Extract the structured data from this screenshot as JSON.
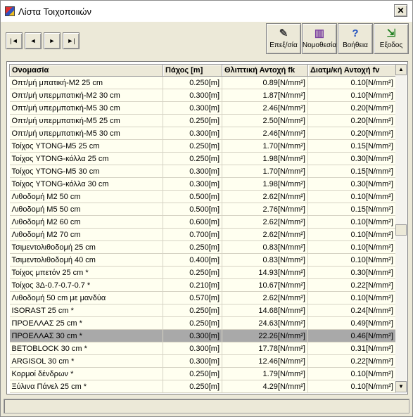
{
  "window": {
    "title": "Λίστα Τοιχοποιιών"
  },
  "toolbar": {
    "buttons": [
      {
        "label": "Επεξ/σία",
        "icon": "edit-icon"
      },
      {
        "label": "Νομοθεσία",
        "icon": "books-icon"
      },
      {
        "label": "Βοήθεια",
        "icon": "help-icon"
      },
      {
        "label": "Εξοδος",
        "icon": "exit-icon"
      }
    ]
  },
  "nav": {
    "first": "|◄",
    "prev": "◄",
    "next": "►",
    "last": "►|"
  },
  "grid": {
    "columns": [
      "Ονομασία",
      "Πάχος [m]",
      "Θλιπτική Αντοχή fk",
      "Διατμ/κή Αντοχή fv"
    ],
    "rows": [
      {
        "name": "Οπτ/μή μπατική-Μ2 25 cm",
        "thickness": "0.250",
        "tu": "[m]",
        "fk": "0.89",
        "fku": "[N/mm²]",
        "fv": "0.10",
        "fvu": "[N/mm²]"
      },
      {
        "name": "Οπτ/μή υπερμπατική-Μ2 30 cm",
        "thickness": "0.300",
        "tu": "[m]",
        "fk": "1.87",
        "fku": "[N/mm²]",
        "fv": "0.10",
        "fvu": "[N/mm²]"
      },
      {
        "name": "Οπτ/μή υπερμπατική-Μ5 30 cm",
        "thickness": "0.300",
        "tu": "[m]",
        "fk": "2.46",
        "fku": "[N/mm²]",
        "fv": "0.20",
        "fvu": "[N/mm²]"
      },
      {
        "name": "Οπτ/μή υπερμπατική-Μ5 25 cm",
        "thickness": "0.250",
        "tu": "[m]",
        "fk": "2.50",
        "fku": "[N/mm²]",
        "fv": "0.20",
        "fvu": "[N/mm²]"
      },
      {
        "name": "Οπτ/μή υπερμπατική-Μ5 30 cm",
        "thickness": "0.300",
        "tu": "[m]",
        "fk": "2.46",
        "fku": "[N/mm²]",
        "fv": "0.20",
        "fvu": "[N/mm²]"
      },
      {
        "name": "Τοίχος YTONG-Μ5 25 cm",
        "thickness": "0.250",
        "tu": "[m]",
        "fk": "1.70",
        "fku": "[N/mm²]",
        "fv": "0.15",
        "fvu": "[N/mm²]"
      },
      {
        "name": "Τοίχος YTONG-κόλλα 25 cm",
        "thickness": "0.250",
        "tu": "[m]",
        "fk": "1.98",
        "fku": "[N/mm²]",
        "fv": "0.30",
        "fvu": "[N/mm²]"
      },
      {
        "name": "Τοίχος YTONG-Μ5 30 cm",
        "thickness": "0.300",
        "tu": "[m]",
        "fk": "1.70",
        "fku": "[N/mm²]",
        "fv": "0.15",
        "fvu": "[N/mm²]"
      },
      {
        "name": "Τοίχος YTONG-κόλλα 30 cm",
        "thickness": "0.300",
        "tu": "[m]",
        "fk": "1.98",
        "fku": "[N/mm²]",
        "fv": "0.30",
        "fvu": "[N/mm²]"
      },
      {
        "name": "Λιθοδομή Μ2 50 cm",
        "thickness": "0.500",
        "tu": "[m]",
        "fk": "2.62",
        "fku": "[N/mm²]",
        "fv": "0.10",
        "fvu": "[N/mm²]"
      },
      {
        "name": "Λιθοδομή Μ5 50 cm",
        "thickness": "0.500",
        "tu": "[m]",
        "fk": "2.76",
        "fku": "[N/mm²]",
        "fv": "0.15",
        "fvu": "[N/mm²]"
      },
      {
        "name": "Λιθοδομή Μ2 60 cm",
        "thickness": "0.600",
        "tu": "[m]",
        "fk": "2.62",
        "fku": "[N/mm²]",
        "fv": "0.10",
        "fvu": "[N/mm²]"
      },
      {
        "name": "Λιθοδομή Μ2 70 cm",
        "thickness": "0.700",
        "tu": "[m]",
        "fk": "2.62",
        "fku": "[N/mm²]",
        "fv": "0.10",
        "fvu": "[N/mm²]"
      },
      {
        "name": "Τσιμεντολιθοδομή 25 cm",
        "thickness": "0.250",
        "tu": "[m]",
        "fk": "0.83",
        "fku": "[N/mm²]",
        "fv": "0.10",
        "fvu": "[N/mm²]"
      },
      {
        "name": "Τσιμεντολιθοδομή 40 cm",
        "thickness": "0.400",
        "tu": "[m]",
        "fk": "0.83",
        "fku": "[N/mm²]",
        "fv": "0.10",
        "fvu": "[N/mm²]"
      },
      {
        "name": "Τοίχος μπετόν 25 cm *",
        "thickness": "0.250",
        "tu": "[m]",
        "fk": "14.93",
        "fku": "[N/mm²]",
        "fv": "0.30",
        "fvu": "[N/mm²]"
      },
      {
        "name": "Τοίχος 3Δ-0.7-0.7-0.7 *",
        "thickness": "0.210",
        "tu": "[m]",
        "fk": "10.67",
        "fku": "[N/mm²]",
        "fv": "0.22",
        "fvu": "[N/mm²]"
      },
      {
        "name": "Λιθοδομή 50 cm με μανδύα",
        "thickness": "0.570",
        "tu": "[m]",
        "fk": "2.62",
        "fku": "[N/mm²]",
        "fv": "0.10",
        "fvu": "[N/mm²]"
      },
      {
        "name": "ISORAST 25 cm *",
        "thickness": "0.250",
        "tu": "[m]",
        "fk": "14.68",
        "fku": "[N/mm²]",
        "fv": "0.24",
        "fvu": "[N/mm²]"
      },
      {
        "name": "ΠΡΟΕΛΛΑΣ 25 cm *",
        "thickness": "0.250",
        "tu": "[m]",
        "fk": "24.63",
        "fku": "[N/mm²]",
        "fv": "0.49",
        "fvu": "[N/mm²]"
      },
      {
        "name": "ΠΡΟΕΛΛΑΣ 30 cm *",
        "thickness": "0.300",
        "tu": "[m]",
        "fk": "22.26",
        "fku": "[N/mm²]",
        "fv": "0.46",
        "fvu": "[N/mm²]",
        "selected": true
      },
      {
        "name": "BETOBLOCK 30 cm  *",
        "thickness": "0.300",
        "tu": "[m]",
        "fk": "17.78",
        "fku": "[N/mm²]",
        "fv": "0.31",
        "fvu": "[N/mm²]"
      },
      {
        "name": "ARGISOL 30 cm *",
        "thickness": "0.300",
        "tu": "[m]",
        "fk": "12.46",
        "fku": "[N/mm²]",
        "fv": "0.22",
        "fvu": "[N/mm²]"
      },
      {
        "name": "Κορμοί δένδρων *",
        "thickness": "0.250",
        "tu": "[m]",
        "fk": "1.79",
        "fku": "[N/mm²]",
        "fv": "0.10",
        "fvu": "[N/mm²]"
      },
      {
        "name": "Ξύλινα Πάνελ 25 cm *",
        "thickness": "0.250",
        "tu": "[m]",
        "fk": "4.29",
        "fku": "[N/mm²]",
        "fv": "0.10",
        "fvu": "[N/mm²]"
      }
    ]
  },
  "status": {
    "text": ""
  }
}
